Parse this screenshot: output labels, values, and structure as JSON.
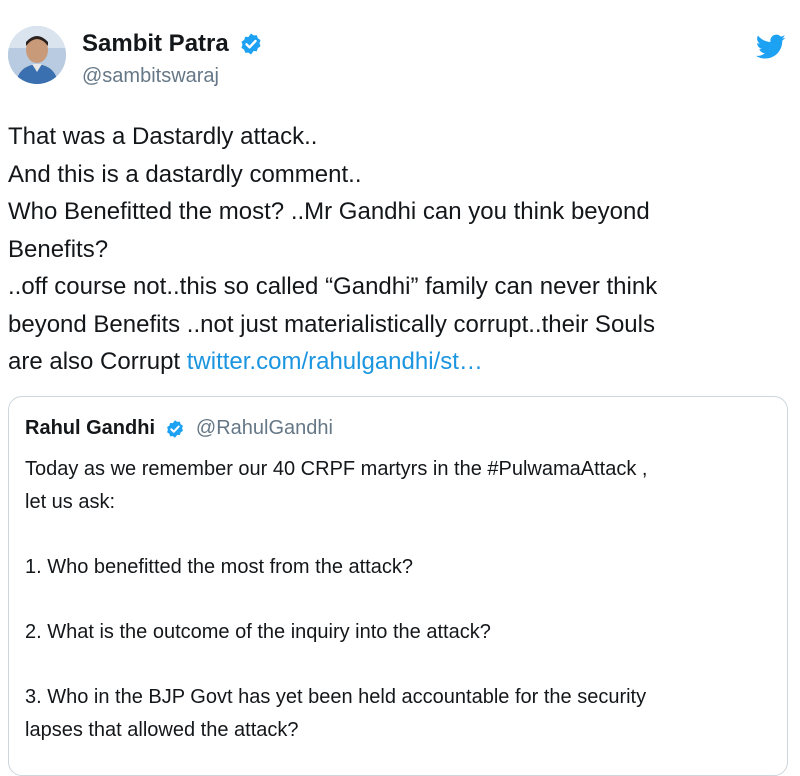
{
  "tweet": {
    "display_name": "Sambit Patra",
    "handle": "@sambitswaraj",
    "avatar_icon": "avatar-photo",
    "verified_icon": "verified-badge-icon",
    "brand_icon": "twitter-bird-icon",
    "brand_color": "#1da1f2",
    "lines": [
      "That was a Dastardly attack..",
      "And this is a dastardly comment..",
      "Who Benefitted the most? ..Mr Gandhi can you think beyond",
      "Benefits?",
      "..off course not..this so called “Gandhi” family can never think",
      "beyond Benefits ..not just materialistically corrupt..their Souls"
    ],
    "last_line_text": "are also Corrupt ",
    "link_text": "twitter.com/rahulgandhi/st…",
    "link_color": "#1b95e0"
  },
  "quoted_tweet": {
    "display_name": "Rahul Gandhi",
    "handle": "@RahulGandhi",
    "intro_lines": [
      "Today as we remember our 40 CRPF martyrs in the #PulwamaAttack ,",
      "let us ask:"
    ],
    "question_1": "1. Who benefitted the most from the attack?",
    "question_2": "2. What is the outcome of the inquiry into the attack?",
    "question_3_lines": [
      "3. Who in the BJP Govt has yet been held accountable for the security",
      "lapses that allowed the attack?"
    ]
  }
}
